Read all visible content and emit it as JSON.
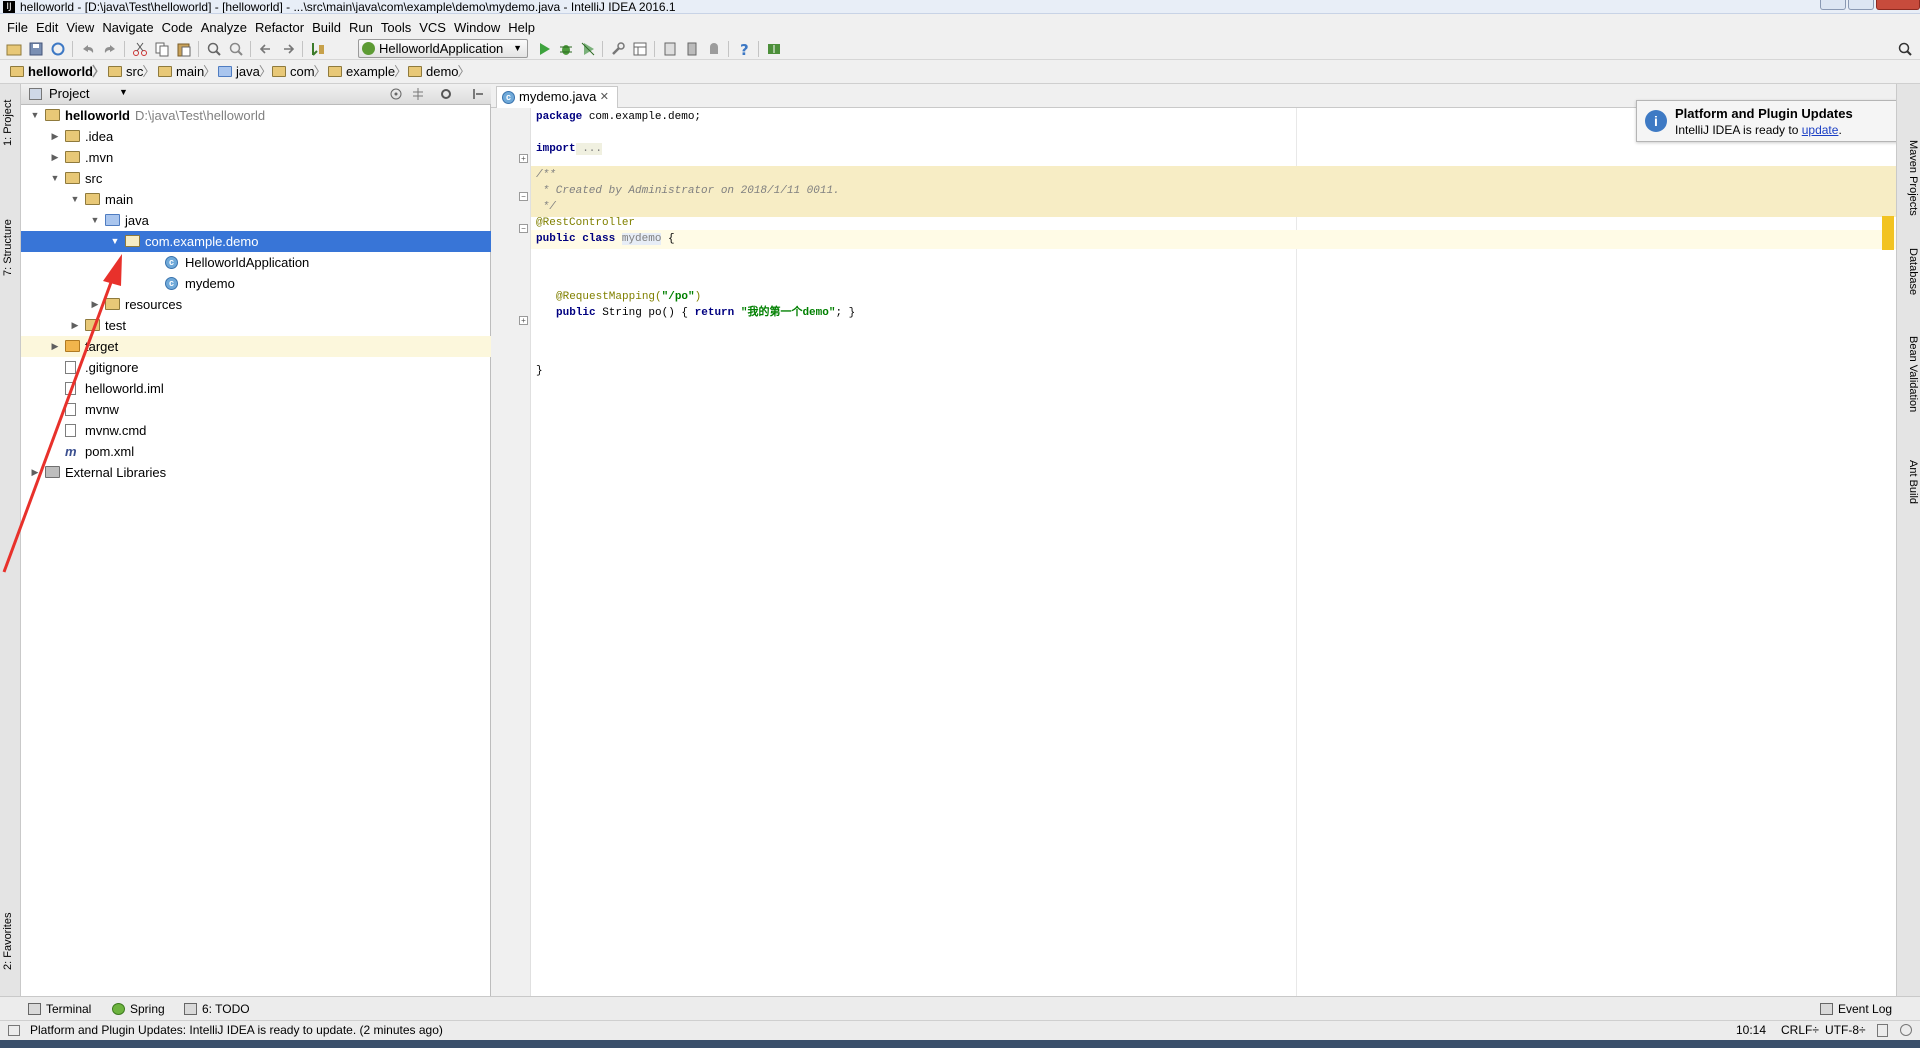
{
  "window": {
    "title": "helloworld - [D:\\java\\Test\\helloworld] - [helloworld] - ...\\src\\main\\java\\com\\example\\demo\\mydemo.java - IntelliJ IDEA 2016.1",
    "app_icon": "IJ"
  },
  "menu": [
    "File",
    "Edit",
    "View",
    "Navigate",
    "Code",
    "Analyze",
    "Refactor",
    "Build",
    "Run",
    "Tools",
    "VCS",
    "Window",
    "Help"
  ],
  "toolbar": {
    "run_config": "HelloworldApplication"
  },
  "breadcrumb": [
    "helloworld",
    "src",
    "main",
    "java",
    "com",
    "example",
    "demo"
  ],
  "left_strip": {
    "project": "1: Project",
    "structure": "7: Structure",
    "favorites": "2: Favorites"
  },
  "project_panel": {
    "header": "Project",
    "tree": [
      {
        "label": "helloworld",
        "path": "D:\\java\\Test\\helloworld",
        "depth": 0,
        "toggle": "▼",
        "icon": "folder",
        "bold": true
      },
      {
        "label": ".idea",
        "depth": 1,
        "toggle": "▶",
        "icon": "folder"
      },
      {
        "label": ".mvn",
        "depth": 1,
        "toggle": "▶",
        "icon": "folder"
      },
      {
        "label": "src",
        "depth": 1,
        "toggle": "▼",
        "icon": "folder"
      },
      {
        "label": "main",
        "depth": 2,
        "toggle": "▼",
        "icon": "folder"
      },
      {
        "label": "java",
        "depth": 3,
        "toggle": "▼",
        "icon": "folder-blue"
      },
      {
        "label": "com.example.demo",
        "depth": 4,
        "toggle": "▼",
        "icon": "package",
        "selected": true
      },
      {
        "label": "HelloworldApplication",
        "depth": 6,
        "toggle": "",
        "icon": "class"
      },
      {
        "label": "mydemo",
        "depth": 6,
        "toggle": "",
        "icon": "class"
      },
      {
        "label": "resources",
        "depth": 3,
        "toggle": "▶",
        "icon": "folder"
      },
      {
        "label": "test",
        "depth": 2,
        "toggle": "▶",
        "icon": "folder"
      },
      {
        "label": "target",
        "depth": 1,
        "toggle": "▶",
        "icon": "folder-orange",
        "highlight": true
      },
      {
        "label": ".gitignore",
        "depth": 1,
        "toggle": "",
        "icon": "file"
      },
      {
        "label": "helloworld.iml",
        "depth": 1,
        "toggle": "",
        "icon": "file"
      },
      {
        "label": "mvnw",
        "depth": 1,
        "toggle": "",
        "icon": "file"
      },
      {
        "label": "mvnw.cmd",
        "depth": 1,
        "toggle": "",
        "icon": "file"
      },
      {
        "label": "pom.xml",
        "depth": 1,
        "toggle": "",
        "icon": "maven"
      },
      {
        "label": "External Libraries",
        "depth": 0,
        "toggle": "▶",
        "icon": "library"
      }
    ]
  },
  "editor": {
    "tab": "mydemo.java",
    "code": {
      "l1_kw": "package",
      "l1_rest": " com.example.demo;",
      "l2_kw": "import",
      "l2_rest": " ...",
      "c1": "/**",
      "c2": " * Created by Administrator on 2018/1/11 0011.",
      "c3": " */",
      "ann1": "@RestController",
      "l4_kw1": "public",
      "l4_kw2": "class",
      "l4_name": "mydemo",
      "l4_rest": " {",
      "ann2": "@RequestMapping(",
      "ann2_str": "\"/po\"",
      "ann2_close": ")",
      "l6_kw": "public",
      "l6_mid": " String po() { ",
      "l6_ret": "return",
      "l6_str": "\"我的第一个demo\"",
      "l6_end": "; }",
      "close": "}"
    }
  },
  "notification": {
    "title": "Platform and Plugin Updates",
    "body_prefix": "IntelliJ IDEA is ready to ",
    "body_link": "update",
    "body_suffix": "."
  },
  "right_strip": [
    "Maven Projects",
    "Database",
    "Bean Validation",
    "Ant Build"
  ],
  "bottom_tools": {
    "terminal": "Terminal",
    "spring": "Spring",
    "todo": "6: TODO",
    "event_log": "Event Log"
  },
  "status": {
    "message": "Platform and Plugin Updates: IntelliJ IDEA is ready to update. (2 minutes ago)",
    "position": "10:14",
    "line_sep": "CRLF÷",
    "encoding": "UTF-8÷"
  },
  "colors": {
    "selection": "#3875d7",
    "arrow": "#e8312b"
  }
}
